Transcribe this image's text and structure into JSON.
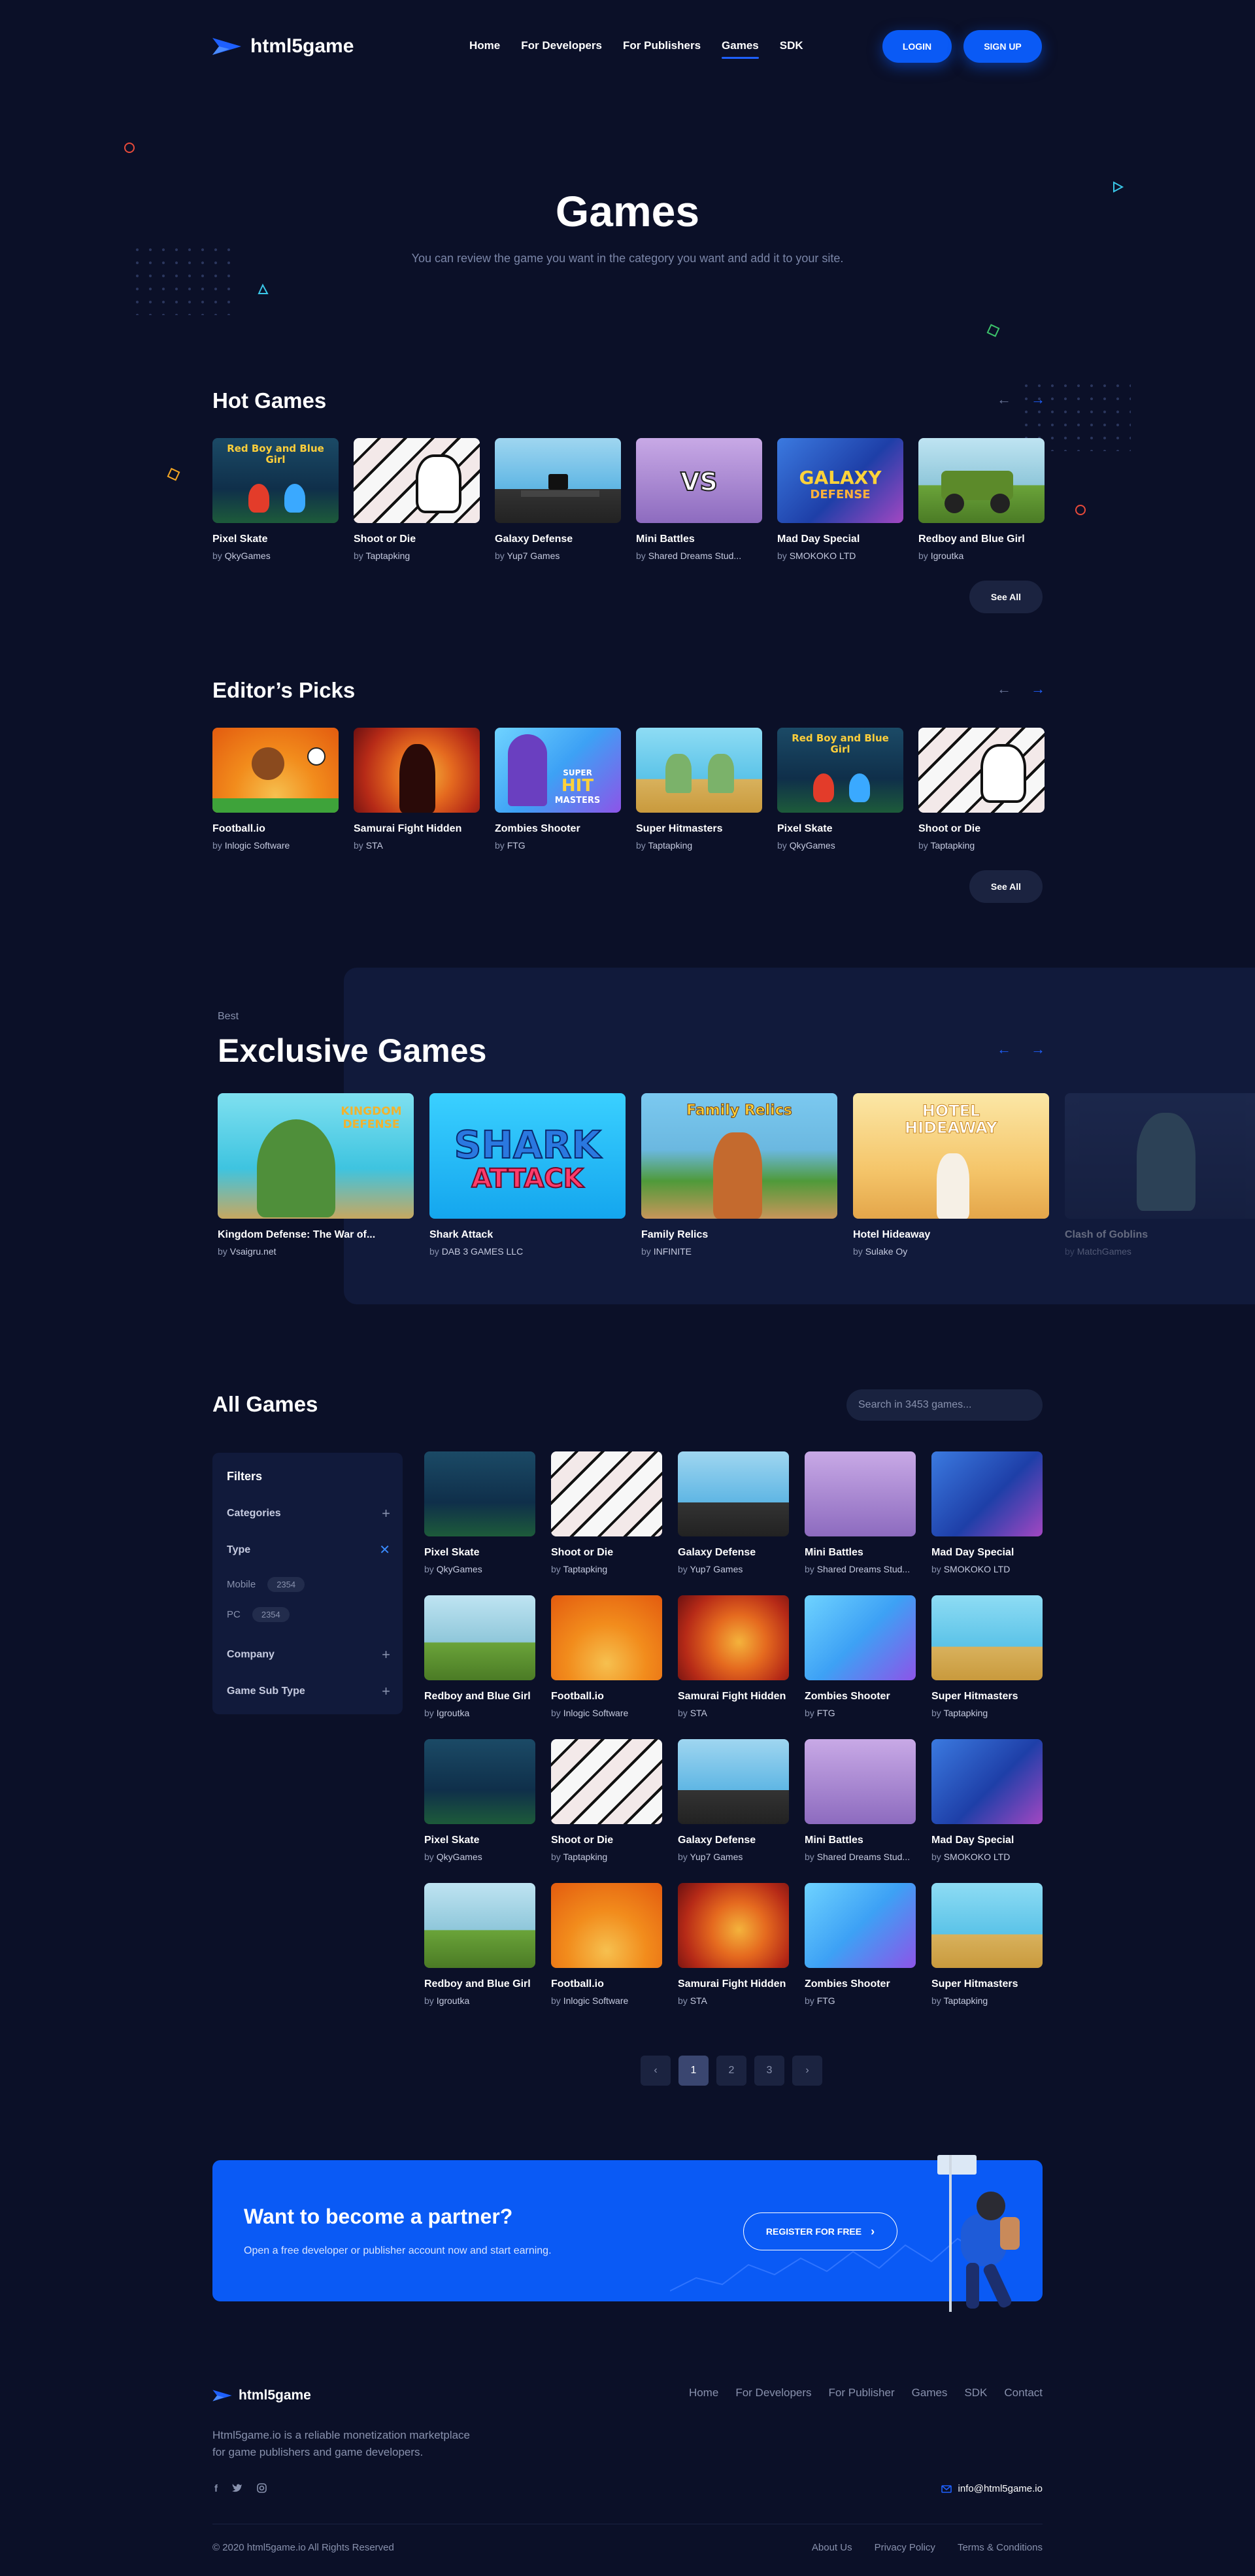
{
  "header": {
    "brand": "html5game",
    "nav": [
      {
        "label": "Home"
      },
      {
        "label": "For Developers"
      },
      {
        "label": "For Publishers"
      },
      {
        "label": "Games"
      },
      {
        "label": "SDK"
      }
    ],
    "active_nav": "Games",
    "login": "LOGIN",
    "signup": "SIGN UP"
  },
  "hero": {
    "title": "Games",
    "subtitle": "You can review the game you want in the category you want and add it to your site."
  },
  "hot": {
    "title": "Hot Games",
    "see_all": "See All",
    "games": [
      {
        "name": "Pixel Skate",
        "by": "by",
        "author": "QkyGames"
      },
      {
        "name": "Shoot or Die",
        "by": "by",
        "author": "Taptapking"
      },
      {
        "name": "Galaxy Defense",
        "by": "by",
        "author": "Yup7 Games"
      },
      {
        "name": "Mini Battles",
        "by": "by",
        "author": "Shared Dreams Stud..."
      },
      {
        "name": "Mad Day Special",
        "by": "by",
        "author": "SMOKOKO LTD"
      },
      {
        "name": "Redboy and Blue Girl",
        "by": "by",
        "author": "Igroutka"
      }
    ]
  },
  "editors": {
    "title": "Editor’s Picks",
    "see_all": "See All",
    "games": [
      {
        "name": "Football.io",
        "by": "by",
        "author": "Inlogic Software"
      },
      {
        "name": "Samurai Fight Hidden",
        "by": "by",
        "author": "STA"
      },
      {
        "name": "Zombies Shooter",
        "by": "by",
        "author": "FTG"
      },
      {
        "name": "Super Hitmasters",
        "by": "by",
        "author": "Taptapking"
      },
      {
        "name": "Pixel Skate",
        "by": "by",
        "author": "QkyGames"
      },
      {
        "name": "Shoot or Die",
        "by": "by",
        "author": "Taptapking"
      }
    ]
  },
  "exclusive": {
    "eyebrow": "Best",
    "title": "Exclusive Games",
    "games": [
      {
        "name": "Kingdom Defense: The War of...",
        "by": "by",
        "author": "Vsaigru.net"
      },
      {
        "name": "Shark Attack",
        "by": "by",
        "author": "DAB 3 GAMES LLC"
      },
      {
        "name": "Family Relics",
        "by": "by",
        "author": "INFINITE"
      },
      {
        "name": "Hotel Hideaway",
        "by": "by",
        "author": "Sulake Oy"
      },
      {
        "name": "Clash of Goblins",
        "by": "by",
        "author": "MatchGames"
      }
    ]
  },
  "thumb_text": {
    "redboy": "Red Boy and Blue Girl",
    "vs": "VS",
    "galaxy": "GALAXY",
    "defense": "DEFENSE",
    "super": "SUPER",
    "hit": "HIT",
    "masters": "MASTERS",
    "kingdom": "KINGDOM DEFENSE",
    "shark1": "SHARK",
    "shark2": "ATTACK",
    "family": "Family Relics",
    "hotel": "HOTEL HIDEAWAY"
  },
  "all": {
    "title": "All Games",
    "search_placeholder": "Search in 3453 games...",
    "filters": {
      "title": "Filters",
      "categories": "Categories",
      "type": "Type",
      "mobile": "Mobile",
      "mobile_count": "2354",
      "pc": "PC",
      "pc_count": "2354",
      "company": "Company",
      "subtype": "Game Sub Type"
    },
    "games": [
      {
        "name": "Pixel Skate",
        "by": "by",
        "author": "QkyGames"
      },
      {
        "name": "Shoot or Die",
        "by": "by",
        "author": "Taptapking"
      },
      {
        "name": "Galaxy Defense",
        "by": "by",
        "author": "Yup7 Games"
      },
      {
        "name": "Mini Battles",
        "by": "by",
        "author": "Shared Dreams Stud..."
      },
      {
        "name": "Mad Day Special",
        "by": "by",
        "author": "SMOKOKO LTD"
      },
      {
        "name": "Redboy and Blue Girl",
        "by": "by",
        "author": "Igroutka"
      },
      {
        "name": "Football.io",
        "by": "by",
        "author": "Inlogic Software"
      },
      {
        "name": "Samurai Fight Hidden",
        "by": "by",
        "author": "STA"
      },
      {
        "name": "Zombies Shooter",
        "by": "by",
        "author": "FTG"
      },
      {
        "name": "Super Hitmasters",
        "by": "by",
        "author": "Taptapking"
      },
      {
        "name": "Pixel Skate",
        "by": "by",
        "author": "QkyGames"
      },
      {
        "name": "Shoot or Die",
        "by": "by",
        "author": "Taptapking"
      },
      {
        "name": "Galaxy Defense",
        "by": "by",
        "author": "Yup7 Games"
      },
      {
        "name": "Mini Battles",
        "by": "by",
        "author": "Shared Dreams Stud..."
      },
      {
        "name": "Mad Day Special",
        "by": "by",
        "author": "SMOKOKO LTD"
      },
      {
        "name": "Redboy and Blue Girl",
        "by": "by",
        "author": "Igroutka"
      },
      {
        "name": "Football.io",
        "by": "by",
        "author": "Inlogic Software"
      },
      {
        "name": "Samurai Fight Hidden",
        "by": "by",
        "author": "STA"
      },
      {
        "name": "Zombies Shooter",
        "by": "by",
        "author": "FTG"
      },
      {
        "name": "Super Hitmasters",
        "by": "by",
        "author": "Taptapking"
      }
    ],
    "pages": [
      "1",
      "2",
      "3"
    ],
    "current_page": "1"
  },
  "partner": {
    "title": "Want to become a partner?",
    "text": "Open a free developer or publisher account now and start earning.",
    "button": "REGISTER FOR FREE"
  },
  "footer": {
    "brand": "html5game",
    "links": [
      "Home",
      "For Developers",
      "For Publisher",
      "Games",
      "SDK",
      "Contact"
    ],
    "desc1": "Html5game.io is a reliable monetization marketplace",
    "desc2": "for game publishers and game developers.",
    "email": "info@html5game.io",
    "copyright": "© 2020 html5game.io All Rights Reserved",
    "bottom_links": [
      "About Us",
      "Privacy Policy",
      "Terms & Conditions"
    ]
  },
  "colors": {
    "background": "#0b1028",
    "accent": "#0a5af5",
    "panel": "#111a3b"
  }
}
